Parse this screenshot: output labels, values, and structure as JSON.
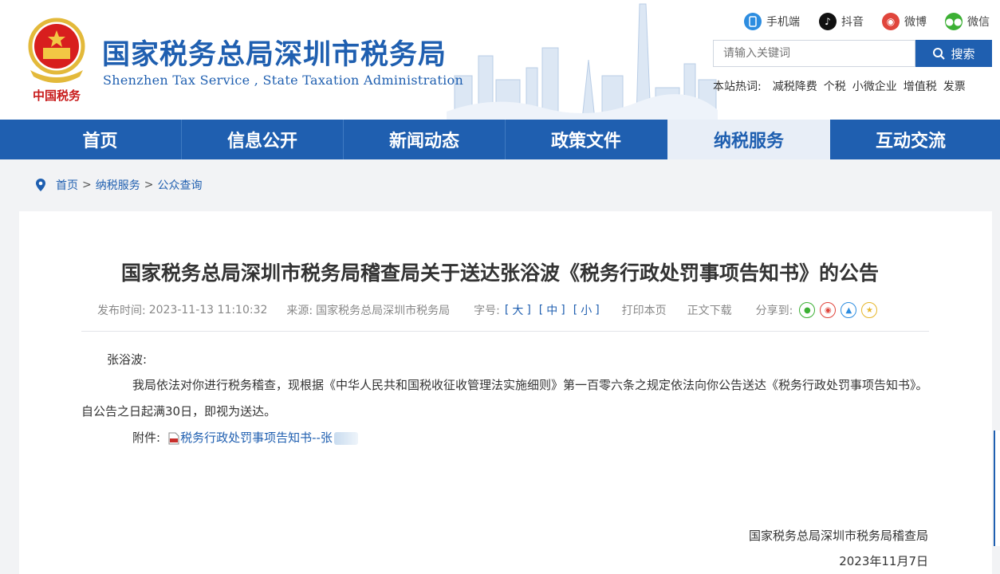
{
  "header": {
    "title": "国家税务总局深圳市税务局",
    "subtitle": "Shenzhen  Tax  Service , State Taxation  Administration",
    "emblem_caption": "中国税务",
    "social": [
      {
        "name": "手机端",
        "icon": "mobile-icon",
        "color": "#2d8de0"
      },
      {
        "name": "抖音",
        "icon": "douyin-icon",
        "color": "#111111"
      },
      {
        "name": "微博",
        "icon": "weibo-icon",
        "color": "#e0453c"
      },
      {
        "name": "微信",
        "icon": "wechat-icon",
        "color": "#3cb034"
      }
    ],
    "search": {
      "placeholder": "请输入关键词",
      "button": "搜索"
    },
    "hotwords": {
      "label": "本站热词:",
      "items": [
        "减税降费",
        "个税",
        "小微企业",
        "增值税",
        "发票"
      ]
    }
  },
  "nav": {
    "items": [
      "首页",
      "信息公开",
      "新闻动态",
      "政策文件",
      "纳税服务",
      "互动交流"
    ],
    "active": "纳税服务"
  },
  "breadcrumb": {
    "home": "首页",
    "level1": "纳税服务",
    "level2": "公众查询",
    "separator": ">"
  },
  "article": {
    "title": "国家税务总局深圳市税务局稽查局关于送达张浴波《税务行政处罚事项告知书》的公告",
    "meta": {
      "published_label": "发布时间:",
      "published": "2023-11-13 11:10:32",
      "source_label": "来源:",
      "source": "国家税务总局深圳市税务局",
      "fontsize_label": "字号:",
      "font_large": "大",
      "font_medium": "中",
      "font_small": "小",
      "print": "打印本页",
      "download": "正文下载",
      "share_label": "分享到:"
    },
    "salutation": "张浴波:",
    "paragraph": "我局依法对你进行税务稽查，现根据《中华人民共和国税收征收管理法实施细则》第一百零六条之规定依法向你公告送达《税务行政处罚事项告知书》。自公告之日起满30日，即视为送达。",
    "attachment_label": "附件:",
    "attachment_link": "税务行政处罚事项告知书--张",
    "signature_org": "国家税务总局深圳市税务局稽查局",
    "signature_date": "2023年11月7日"
  },
  "colors": {
    "primary": "#1f5fb0",
    "active_nav_bg": "#e8eef7",
    "page_bg": "#f2f3f5"
  }
}
